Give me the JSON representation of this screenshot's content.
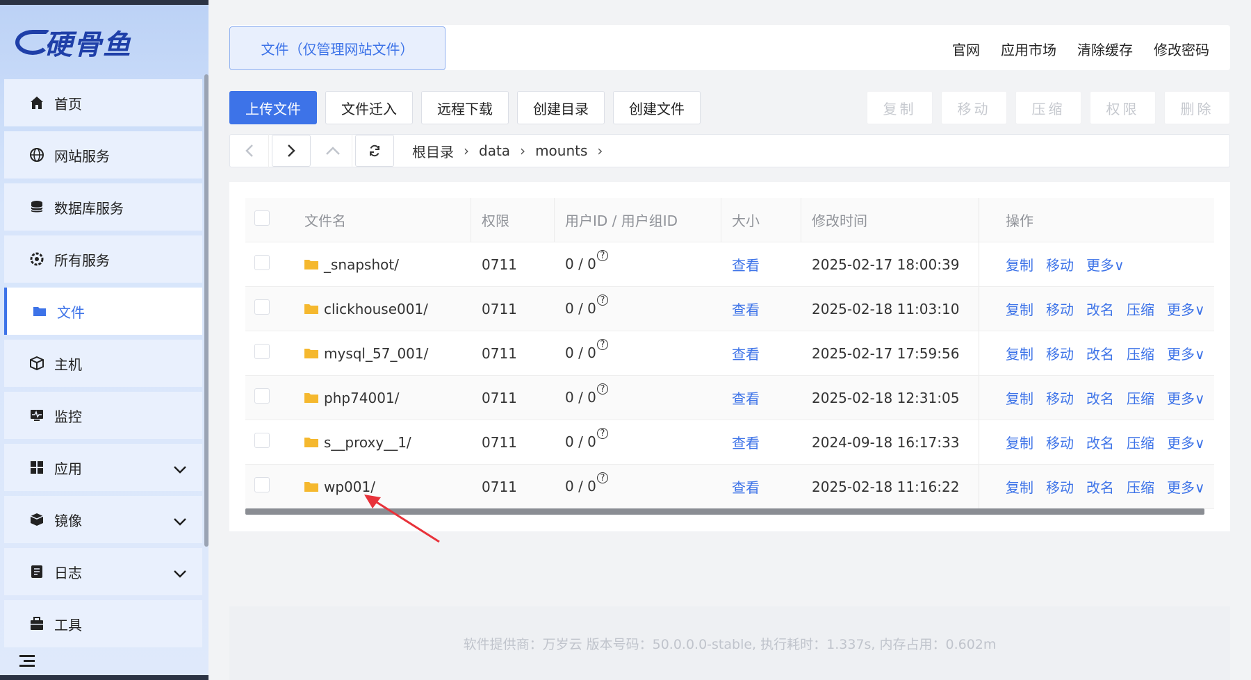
{
  "brand": {
    "logo_text": "硬骨鱼"
  },
  "sidebar": {
    "items": [
      {
        "label": "首页",
        "icon": "home-icon"
      },
      {
        "label": "网站服务",
        "icon": "globe-icon"
      },
      {
        "label": "数据库服务",
        "icon": "database-icon"
      },
      {
        "label": "所有服务",
        "icon": "services-icon"
      },
      {
        "label": "文件",
        "icon": "folder-icon",
        "active": true
      },
      {
        "label": "主机",
        "icon": "host-icon"
      },
      {
        "label": "监控",
        "icon": "monitor-icon"
      },
      {
        "label": "应用",
        "icon": "apps-icon",
        "expandable": true
      },
      {
        "label": "镜像",
        "icon": "image-icon",
        "expandable": true
      },
      {
        "label": "日志",
        "icon": "log-icon",
        "expandable": true
      },
      {
        "label": "工具",
        "icon": "toolbox-icon"
      }
    ]
  },
  "header": {
    "page_tab": "文件（仅管理网站文件）",
    "links": [
      "官网",
      "应用市场",
      "清除缓存",
      "修改密码"
    ]
  },
  "toolbar": {
    "upload": "上传文件",
    "import": "文件迁入",
    "remote_download": "远程下载",
    "create_dir": "创建目录",
    "create_file": "创建文件",
    "copy": "复制",
    "move": "移动",
    "compress": "压缩",
    "permission": "权限",
    "delete": "删除"
  },
  "breadcrumb": [
    "根目录",
    "data",
    "mounts"
  ],
  "table": {
    "headers": {
      "name": "文件名",
      "perm": "权限",
      "uid": "用户ID / 用户组ID",
      "size": "大小",
      "mtime": "修改时间",
      "ops": "操作"
    },
    "rows": [
      {
        "name": "_snapshot/",
        "perm": "0711",
        "uid": "0 / 0",
        "size": "查看",
        "mtime": "2025-02-17 18:00:39"
      },
      {
        "name": "clickhouse001/",
        "perm": "0711",
        "uid": "0 / 0",
        "size": "查看",
        "mtime": "2025-02-18 11:03:10"
      },
      {
        "name": "mysql_57_001/",
        "perm": "0711",
        "uid": "0 / 0",
        "size": "查看",
        "mtime": "2025-02-17 17:59:56"
      },
      {
        "name": "php74001/",
        "perm": "0711",
        "uid": "0 / 0",
        "size": "查看",
        "mtime": "2025-02-18 12:31:05"
      },
      {
        "name": "s__proxy__1/",
        "perm": "0711",
        "uid": "0 / 0",
        "size": "查看",
        "mtime": "2024-09-18 16:17:33"
      },
      {
        "name": "wp001/",
        "perm": "0711",
        "uid": "0 / 0",
        "size": "查看",
        "mtime": "2025-02-18 11:16:22"
      }
    ],
    "ops": {
      "copy": "复制",
      "move": "移动",
      "rename": "改名",
      "compress": "压缩",
      "more": "更多∨"
    }
  },
  "footer": {
    "text": "软件提供商：万岁云    版本号码：50.0.0.0-stable, 执行耗时：1.337s, 内存占用：0.602m"
  },
  "colors": {
    "accent": "#3d73e8",
    "folder": "#f5b82e",
    "arrow": "#e8323a"
  }
}
